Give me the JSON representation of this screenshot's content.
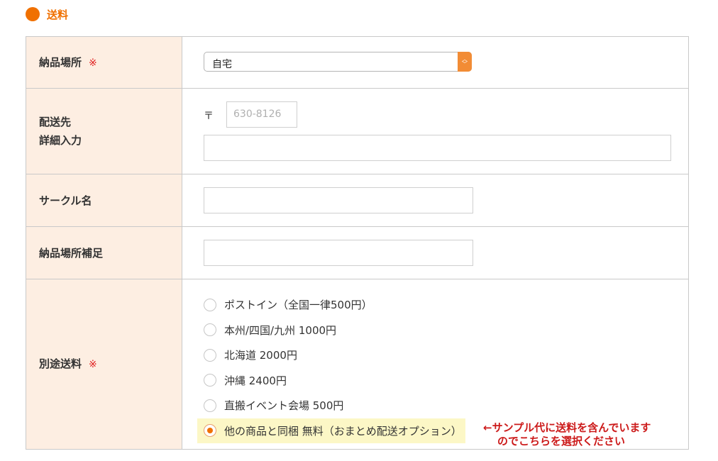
{
  "section": {
    "title": "送料",
    "accent_color": "#f07000"
  },
  "rows": {
    "delivery_place": {
      "label": "納品場所",
      "required_mark": "※",
      "select_value": "自宅"
    },
    "address": {
      "label_line1": "配送先",
      "label_line2": "詳細入力",
      "postal_mark": "〒",
      "postal_placeholder": "630-8126",
      "address_value": ""
    },
    "circle_name": {
      "label": "サークル名",
      "value": ""
    },
    "place_supplement": {
      "label": "納品場所補足",
      "value": ""
    },
    "shipping": {
      "label": "別途送料",
      "required_mark": "※",
      "options": [
        {
          "label": "ポストイン（全国一律500円）",
          "checked": false
        },
        {
          "label": "本州/四国/九州 1000円",
          "checked": false
        },
        {
          "label": "北海道 2000円",
          "checked": false
        },
        {
          "label": "沖縄 2400円",
          "checked": false
        },
        {
          "label": "直搬イベント会場 500円",
          "checked": false
        },
        {
          "label": "他の商品と同梱 無料（おまとめ配送オプション）",
          "checked": true
        }
      ],
      "note_line1": "←サンプル代に送料を含んでいます",
      "note_line2": "のでこちらを選択ください"
    }
  }
}
